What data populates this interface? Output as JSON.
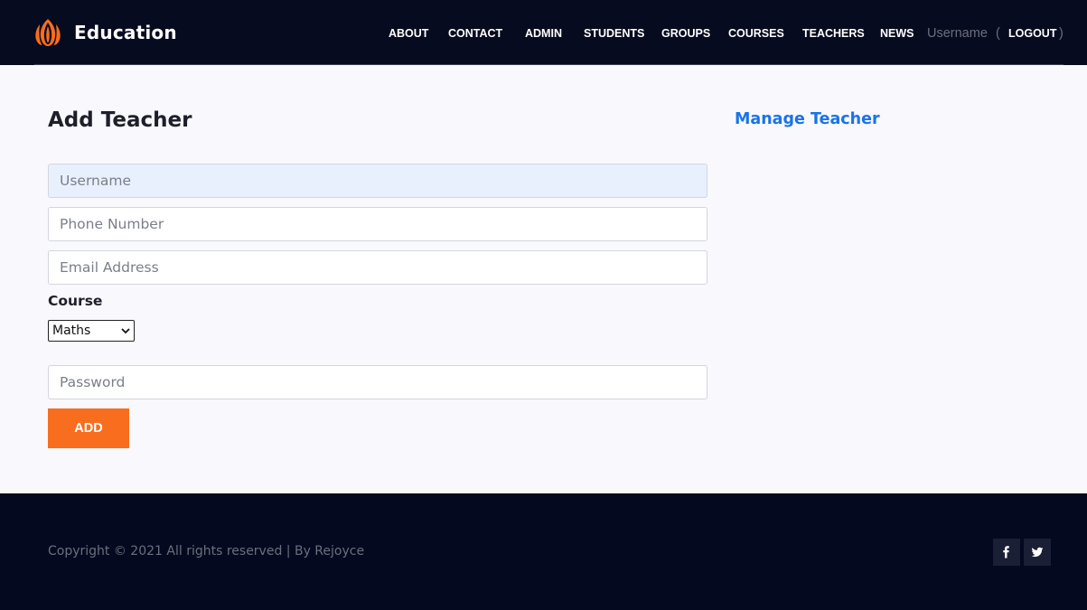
{
  "brand": {
    "name": "Education",
    "accent": "#f86d1e"
  },
  "nav": {
    "items": [
      {
        "label": "ABOUT"
      },
      {
        "label": "CONTACT"
      },
      {
        "label": "ADMIN"
      },
      {
        "label": "STUDENTS"
      },
      {
        "label": "GROUPS"
      },
      {
        "label": "COURSES"
      },
      {
        "label": "TEACHERS"
      },
      {
        "label": "NEWS"
      }
    ],
    "user": "Username",
    "open_paren": "(",
    "logout": "LOGOUT",
    "close_paren": ")"
  },
  "main": {
    "title": "Add Teacher",
    "manage_link": "Manage Teacher",
    "form": {
      "username_placeholder": "Username",
      "phone_placeholder": "Phone Number",
      "email_placeholder": "Email Address",
      "course_label": "Course",
      "course_selected": "Maths",
      "password_placeholder": "Password",
      "submit_label": "ADD"
    }
  },
  "footer": {
    "copyright": "Copyright © 2021 All rights reserved | By Rejoyce",
    "social_icons": [
      "facebook-icon",
      "twitter-icon"
    ]
  }
}
